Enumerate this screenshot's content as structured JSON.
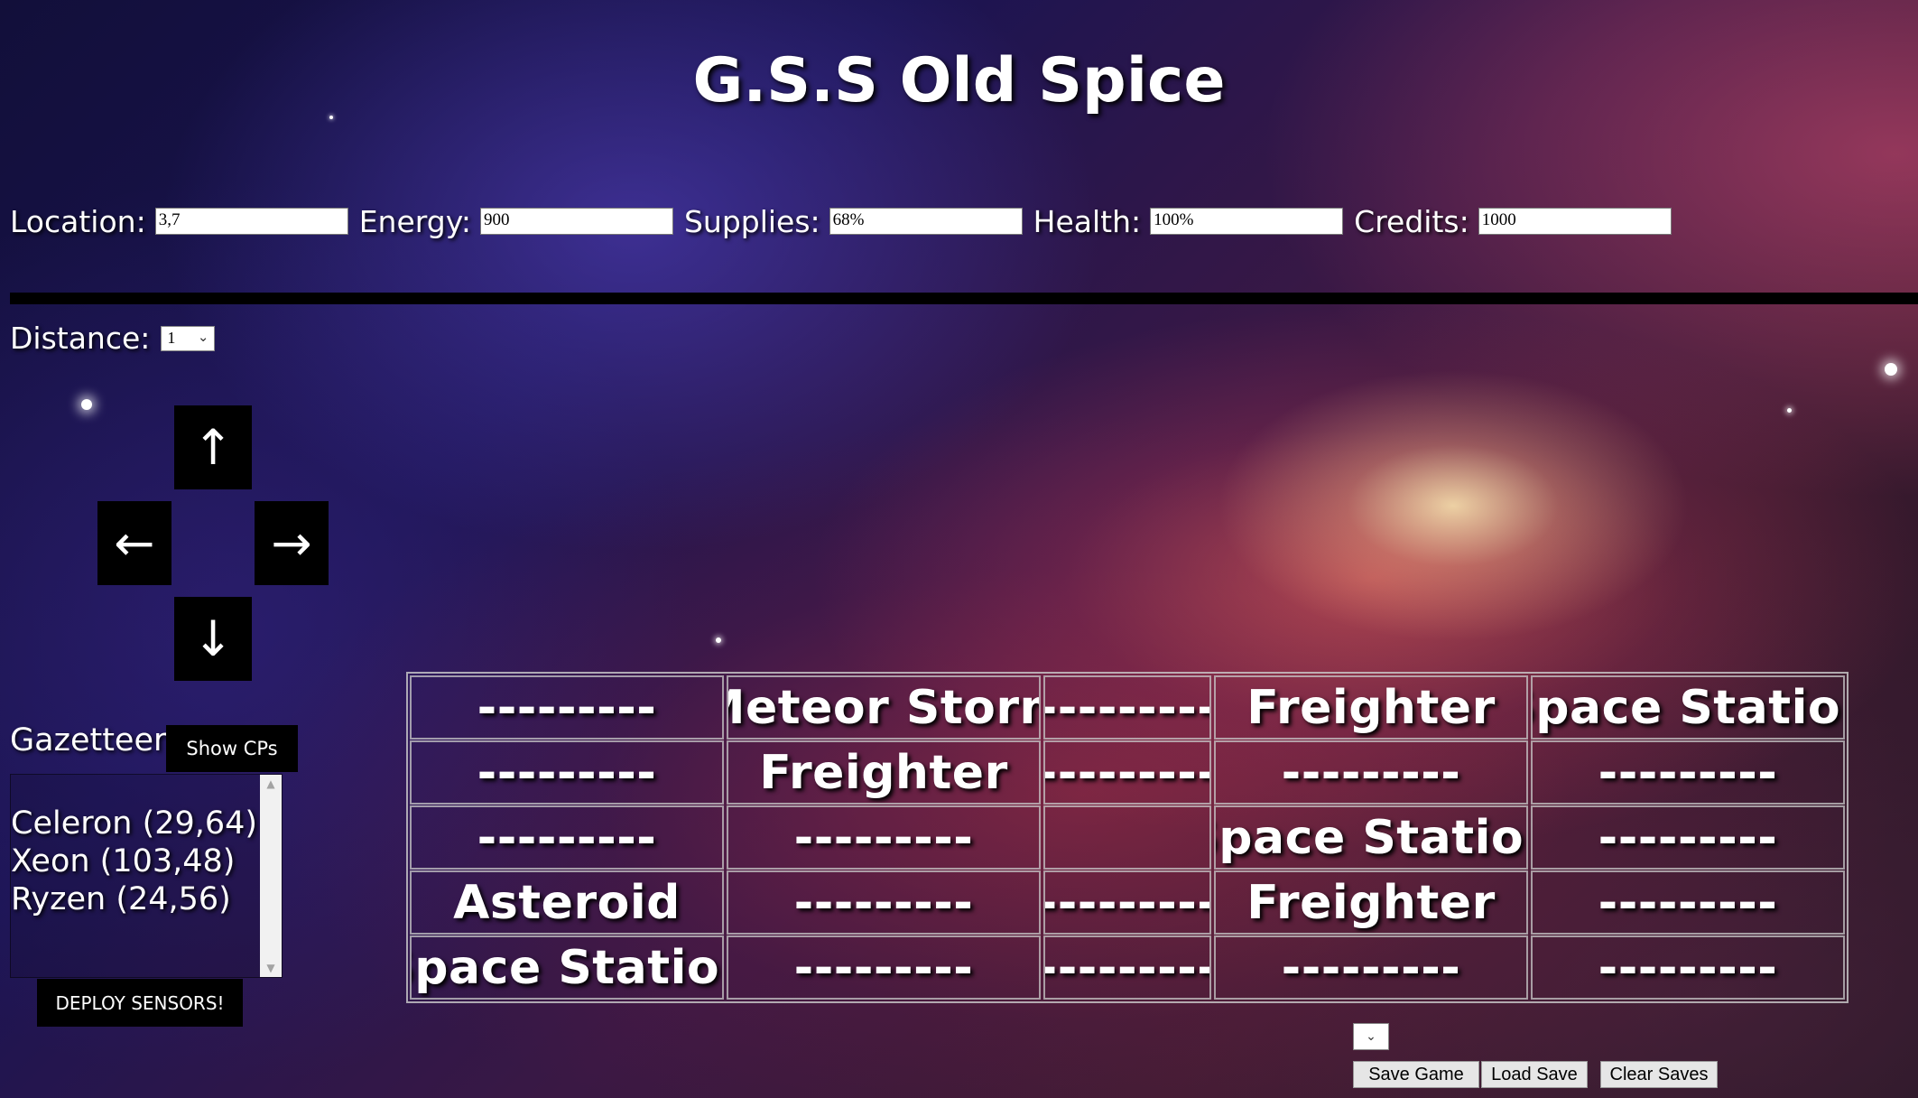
{
  "game": {
    "title": "G.S.S Old Spice"
  },
  "stats": [
    {
      "label": "Location:",
      "value": "3,7"
    },
    {
      "label": "Energy:",
      "value": "900"
    },
    {
      "label": "Supplies:",
      "value": "68%"
    },
    {
      "label": "Health:",
      "value": "100%"
    },
    {
      "label": "Credits:",
      "value": "1000"
    }
  ],
  "navigation": {
    "distance_label": "Distance:",
    "distance_value": "1",
    "arrows": {
      "up": "↑",
      "left": "←",
      "right": "→",
      "down": "↓"
    }
  },
  "gazetteer": {
    "label": "Gazetteer",
    "show_button": "Show CPs",
    "entries": [
      "Celeron (29,64)",
      "Xeon (103,48)",
      "Ryzen (24,56)"
    ],
    "deploy_button": "DEPLOY SENSORS!"
  },
  "sensor_grid": [
    [
      "---------",
      "Meteor Storm",
      "---------",
      "Freighter",
      "Space Station"
    ],
    [
      "---------",
      "Freighter",
      "---------",
      "---------",
      "---------"
    ],
    [
      "---------",
      "---------",
      "",
      "Space Station",
      "---------"
    ],
    [
      "Asteroid",
      "---------",
      "---------",
      "Freighter",
      "---------"
    ],
    [
      "Space Station",
      "---------",
      "---------",
      "---------",
      "---------"
    ]
  ],
  "save_controls": {
    "save_slot_value": "",
    "save_button": "Save Game",
    "load_button": "Load Save",
    "clear_button": "Clear Saves"
  },
  "icons": {
    "dropdown": "chevron-down-icon"
  }
}
